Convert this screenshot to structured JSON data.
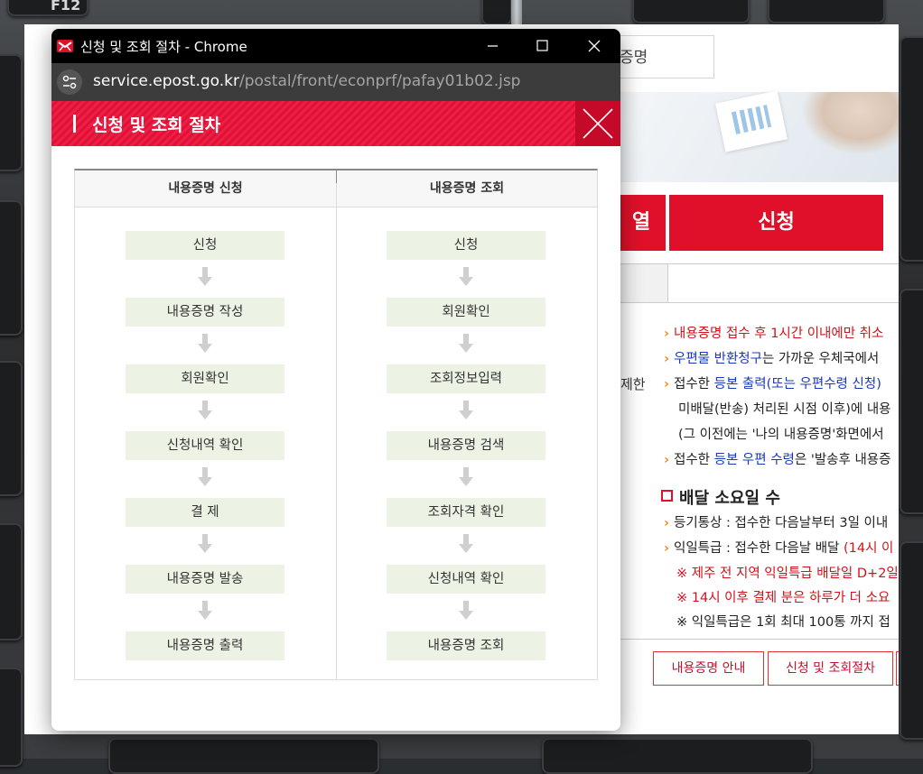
{
  "window": {
    "title": "신청 및 조회 절차 - Chrome",
    "url_host": "service.epost.go.kr",
    "url_path": "/postal/front/econprf/pafay01b02.jsp"
  },
  "popup": {
    "header_title": "신청 및 조회 절차",
    "columns": [
      {
        "heading": "내용증명 신청",
        "steps": [
          "신청",
          "내용증명 작성",
          "회원확인",
          "신청내역 확인",
          "결 제",
          "내용증명 발송",
          "내용증명 출력"
        ]
      },
      {
        "heading": "내용증명 조회",
        "steps": [
          "신청",
          "회원확인",
          "조회정보입력",
          "내용증명 검색",
          "조회자격 확인",
          "신청내역 확인",
          "내용증명 조회"
        ]
      }
    ]
  },
  "background_page": {
    "search_text": "증명",
    "button_left": "열",
    "button_apply": "신청",
    "side_label": "제한",
    "notice_lines": {
      "l1": "내용증명 접수 후 1시간 이내에만 취소",
      "l2a": "우편물 반환청구",
      "l2b": "는 가까운 우체국에서",
      "l3a": "접수한 ",
      "l3b": "등본 출력(또는 우편수령 신청)",
      "l4": "미배달(반송) 처리된 시점 이후)에 내용",
      "l5": "(그 이전에는 '나의 내용증명'화면에서",
      "l6a": "접수한 ",
      "l6b": "등본 우편 수령",
      "l6c": "은 '발송후 내용증"
    },
    "delivery_heading": "배달 소요일 수",
    "delivery_lines": {
      "d1": "등기통상 : 접수한 다음날부터 3일 이내",
      "d2a": "익일특급 : 접수한 다음날 배달 ",
      "d2b": "(14시 이",
      "d3": "※ 제주 전 지역 익일특급 배달일 D+2일",
      "d4": "※ 14시 이후 결제 분은 하루가 더 소요",
      "d5": "※ 익일특급은 1회 최대 100통 까지 접"
    },
    "footer_buttons": [
      "내용증명 안내",
      "신청 및 조회절차"
    ]
  },
  "keyboard": {
    "f12": "F12"
  },
  "colors": {
    "brand_red": "#e0102a",
    "step_bg": "#ecf3e4",
    "arrow": "#cfcfcf"
  },
  "icons": {
    "app": "epost-app-icon",
    "tune": "site-settings-icon",
    "close": "close-icon",
    "arrow": "arrow-down-icon"
  }
}
